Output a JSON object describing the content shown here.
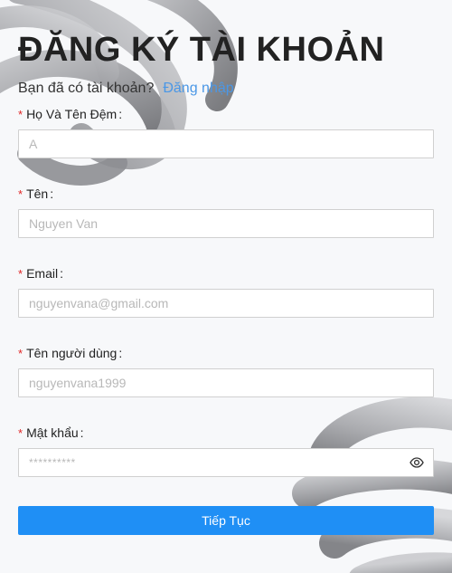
{
  "header": {
    "title": "ĐĂNG KÝ TÀI KHOẢN",
    "login_prompt": "Bạn đã có tài khoản?",
    "login_link": "Đăng nhập"
  },
  "form": {
    "required_mark": "*",
    "label_suffix": ":",
    "fields": [
      {
        "label": "Họ Và Tên Đệm",
        "placeholder": "A",
        "value": ""
      },
      {
        "label": "Tên",
        "placeholder": "Nguyen Van",
        "value": ""
      },
      {
        "label": "Email",
        "placeholder": "nguyenvana@gmail.com",
        "value": ""
      },
      {
        "label": "Tên người dùng",
        "placeholder": "nguyenvana1999",
        "value": ""
      },
      {
        "label": "Mật khẩu",
        "placeholder": "**********",
        "value": "",
        "toggle_icon": "eye-icon"
      }
    ],
    "submit_label": "Tiếp Tục"
  },
  "colors": {
    "primary": "#1f8ff5",
    "link": "#4a97e6",
    "required": "#e02424",
    "background": "#f7f8fa"
  }
}
